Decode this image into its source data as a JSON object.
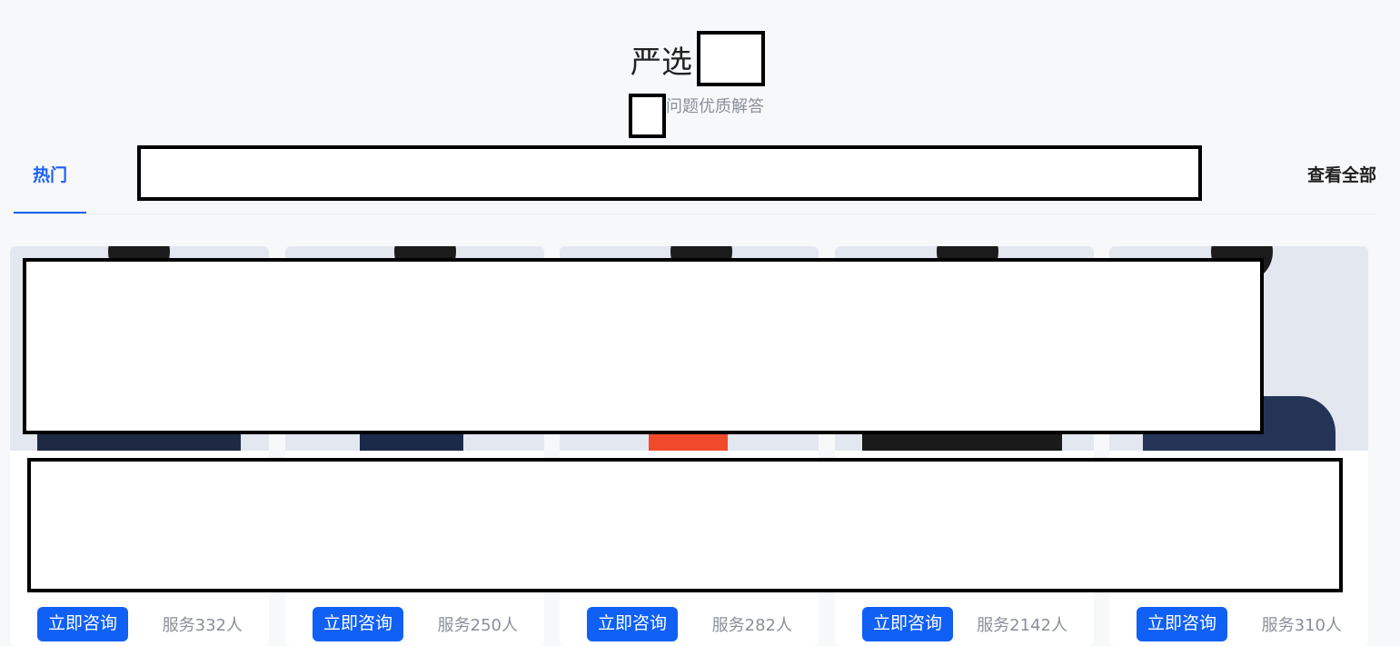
{
  "header": {
    "title": "严选",
    "subtitle": "问题优质解答"
  },
  "tabs": {
    "hot_label": "热门",
    "view_all_label": "查看全部"
  },
  "cards": [
    {
      "consult_label": "立即咨询",
      "served_label": "服务332人",
      "jacket_color": "#1e2a44"
    },
    {
      "consult_label": "立即咨询",
      "served_label": "服务250人",
      "jacket_color": "#1c2a4a"
    },
    {
      "consult_label": "立即咨询",
      "served_label": "服务282人",
      "jacket_color": "#f04a2a"
    },
    {
      "consult_label": "立即咨询",
      "served_label": "服务2142人",
      "jacket_color": "#1a1a1a"
    },
    {
      "consult_label": "立即咨询",
      "served_label": "服务310人",
      "jacket_color": "#233457"
    }
  ],
  "colors": {
    "accent": "#1d5ff5",
    "button": "#1060f5",
    "muted_text": "#8a8f99",
    "page_bg": "#f7f8fa"
  }
}
